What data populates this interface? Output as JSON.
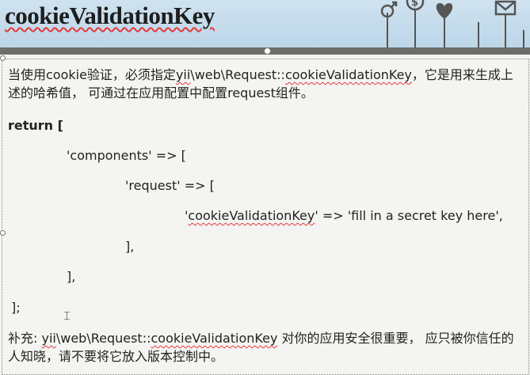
{
  "title": "cookieValidationKey",
  "intro": {
    "before": "当使用cookie验证，必须指定",
    "link_yii": "yii",
    "mid": "\\web\\Request::",
    "link_key": "cookieValidationKey",
    "after": "，它是用来生成上述的哈希值， 可通过在应用配置中配置request组件。"
  },
  "code": {
    "line1": "return [",
    "line2": "'components' => [",
    "line3": "'request' => [",
    "line4_q": "'",
    "line4_key": "cookieValidationKey",
    "line4_rest": "' => 'fill in a secret key here',",
    "line5": "],",
    "line6": "],",
    "line7": "];"
  },
  "note": {
    "before": "补充: ",
    "link_yii": "yii",
    "mid": "\\web\\Request::",
    "link_key": "cookieValidationKey",
    "after": " 对你的应用安全很重要， 应只被你信任的人知晓，请不要将它放入版本控制中。"
  },
  "icons": [
    "gender-icon",
    "dollar-icon",
    "heart-icon",
    "mail-icon"
  ]
}
